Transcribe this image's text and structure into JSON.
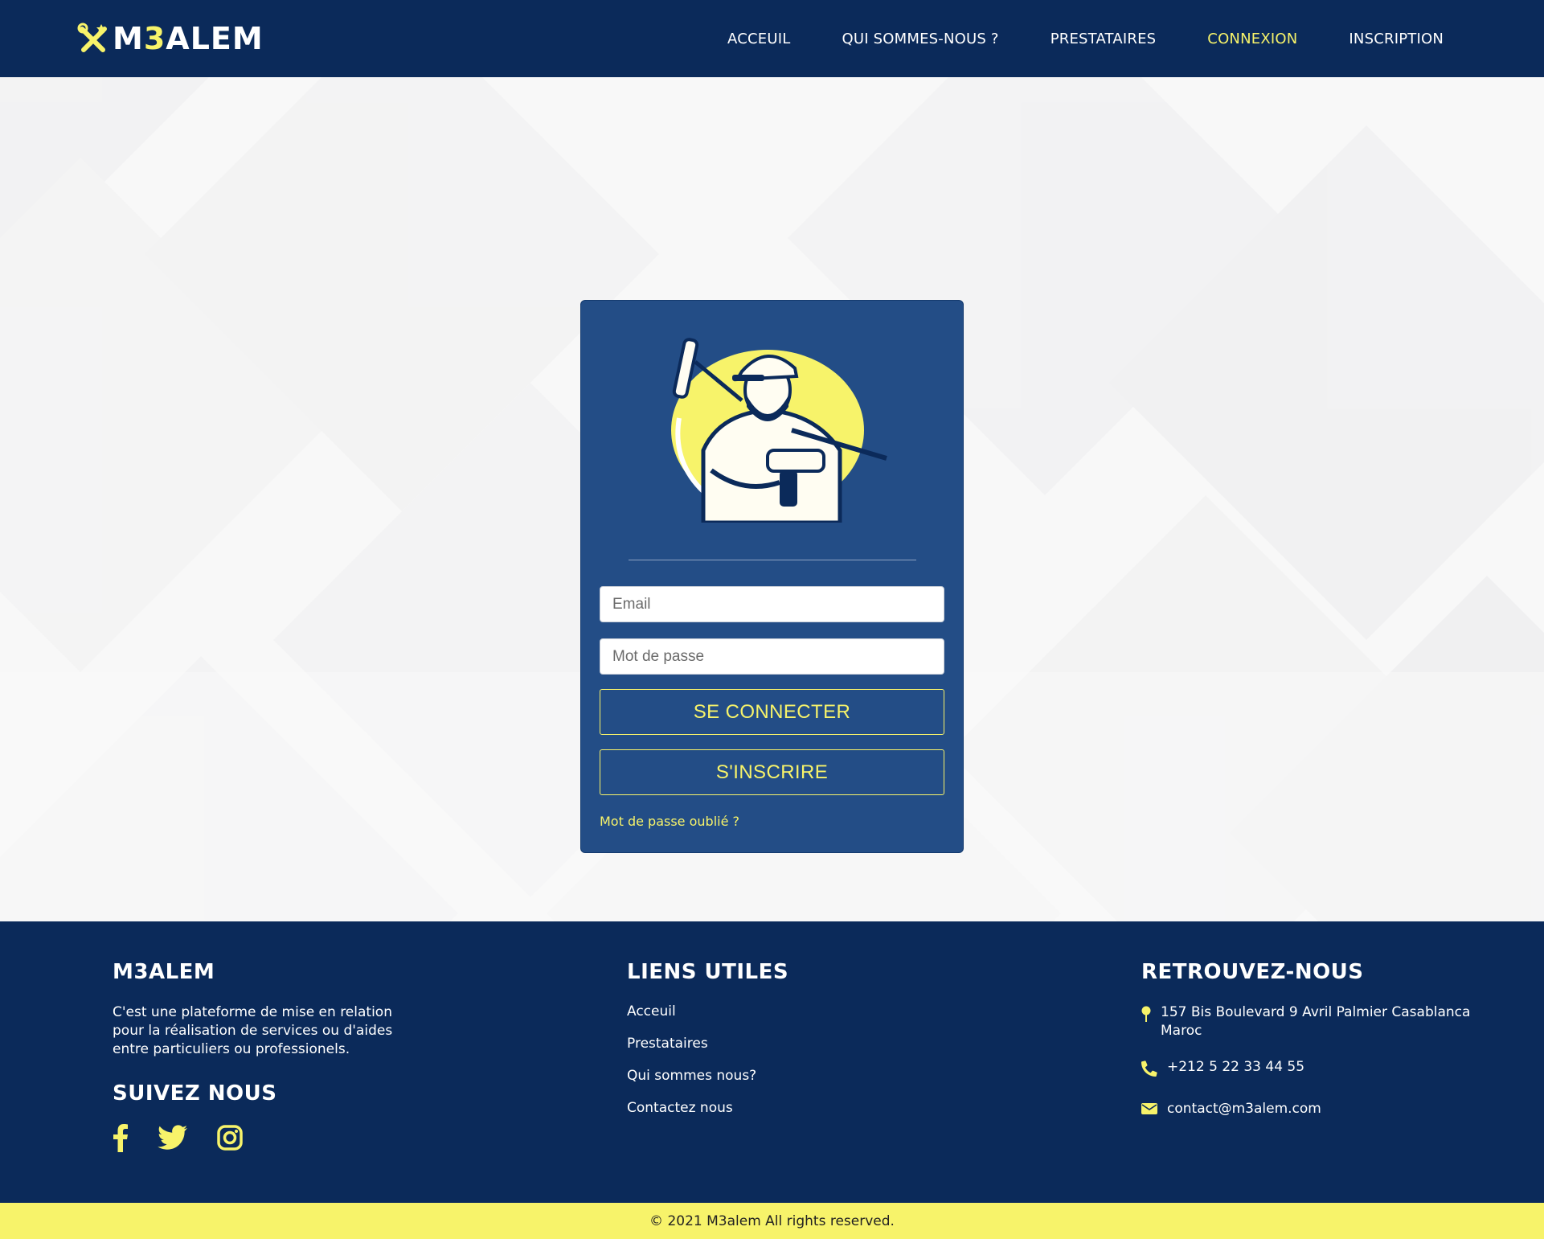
{
  "header": {
    "logo_text_prefix": "M",
    "logo_text_accent": "3",
    "logo_text_suffix": "ALEM",
    "nav": [
      {
        "label": "ACCEUIL",
        "active": false
      },
      {
        "label": "QUI SOMMES-NOUS ?",
        "active": false
      },
      {
        "label": "PRESTATAIRES",
        "active": false
      },
      {
        "label": "CONNEXION",
        "active": true
      },
      {
        "label": "INSCRIPTION",
        "active": false
      }
    ]
  },
  "login": {
    "email_placeholder": "Email",
    "password_placeholder": "Mot de passe",
    "login_button": "SE CONNECTER",
    "register_button": "S'INSCRIRE",
    "forgot_link": "Mot de passe oublié ?"
  },
  "footer": {
    "about": {
      "title": "M3ALEM",
      "text": "C'est une plateforme de mise en relation pour la réalisation de services ou d'aides entre particuliers ou professionels.",
      "follow_title": "SUIVEZ NOUS",
      "socials": [
        "facebook-icon",
        "twitter-icon",
        "instagram-icon"
      ]
    },
    "links": {
      "title": "LIENS UTILES",
      "items": [
        "Acceuil",
        "Prestataires",
        "Qui sommes nous?",
        "Contactez nous"
      ]
    },
    "contact": {
      "title": "RETROUVEZ-NOUS",
      "address": "157 Bis Boulevard 9 Avril Palmier Casablanca Maroc",
      "phone": "+212 5 22 33 44 55",
      "email": "contact@m3alem.com"
    },
    "copyright": "© 2021 M3alem All rights reserved."
  },
  "colors": {
    "navy": "#0b2a5a",
    "card_blue": "#234d86",
    "accent_yellow": "#f7f36a"
  }
}
